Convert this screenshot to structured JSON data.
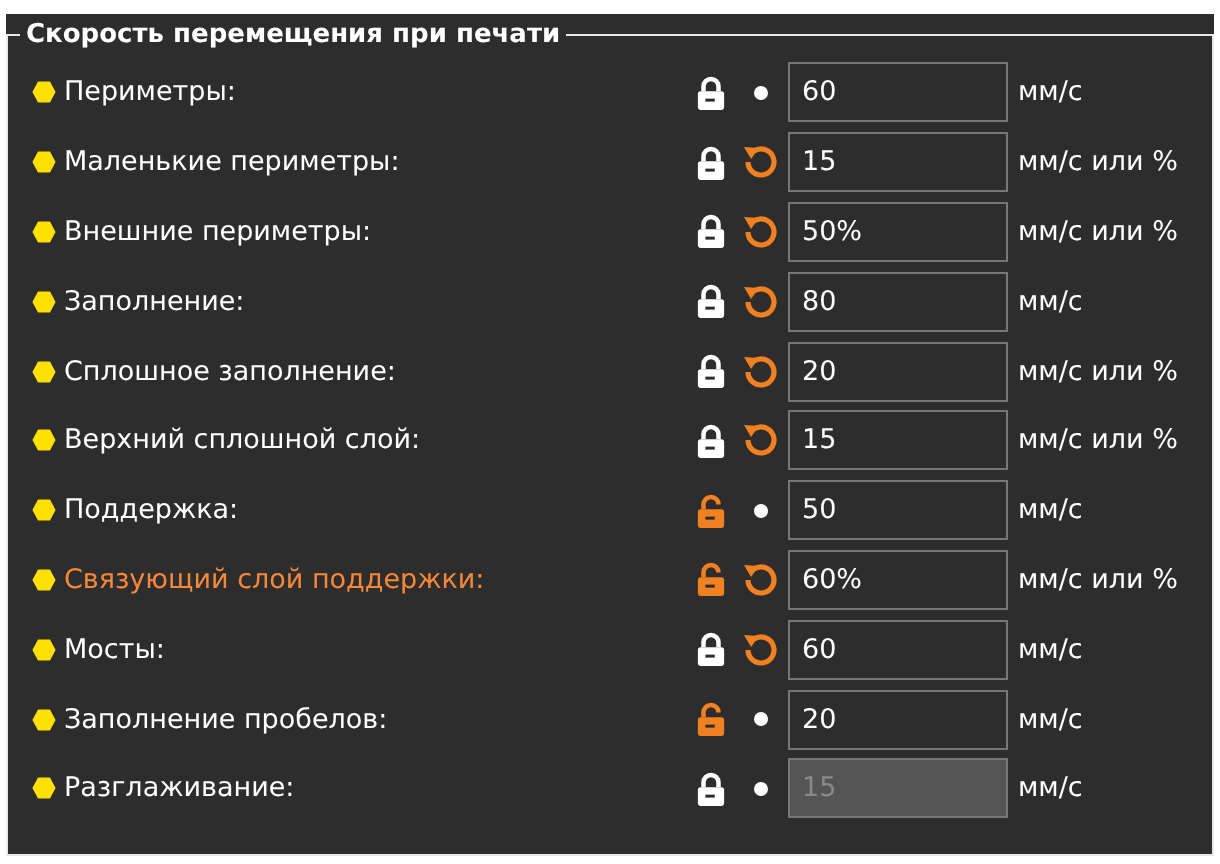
{
  "group": {
    "title": "Скорость перемещения при печати"
  },
  "rows": [
    {
      "label": "Периметры:",
      "locked": true,
      "modified": false,
      "highlighted": false,
      "value": "60",
      "disabled": false,
      "unit": "мм/с"
    },
    {
      "label": "Маленькие периметры:",
      "locked": true,
      "modified": true,
      "highlighted": false,
      "value": "15",
      "disabled": false,
      "unit": "мм/с или %"
    },
    {
      "label": "Внешние периметры:",
      "locked": true,
      "modified": true,
      "highlighted": false,
      "value": "50%",
      "disabled": false,
      "unit": "мм/с или %"
    },
    {
      "label": "Заполнение:",
      "locked": true,
      "modified": true,
      "highlighted": false,
      "value": "80",
      "disabled": false,
      "unit": "мм/с"
    },
    {
      "label": "Сплошное заполнение:",
      "locked": true,
      "modified": true,
      "highlighted": false,
      "value": "20",
      "disabled": false,
      "unit": "мм/с или %"
    },
    {
      "label": "Верхний сплошной слой:",
      "locked": true,
      "modified": true,
      "highlighted": false,
      "value": "15",
      "disabled": false,
      "unit": "мм/с или %"
    },
    {
      "label": "Поддержка:",
      "locked": false,
      "modified": false,
      "highlighted": false,
      "value": "50",
      "disabled": false,
      "unit": "мм/с"
    },
    {
      "label": "Связующий слой поддержки:",
      "locked": false,
      "modified": true,
      "highlighted": true,
      "value": "60%",
      "disabled": false,
      "unit": "мм/с или %"
    },
    {
      "label": "Мосты:",
      "locked": true,
      "modified": true,
      "highlighted": false,
      "value": "60",
      "disabled": false,
      "unit": "мм/с"
    },
    {
      "label": "Заполнение пробелов:",
      "locked": false,
      "modified": false,
      "highlighted": false,
      "value": "20",
      "disabled": false,
      "unit": "мм/с"
    },
    {
      "label": "Разглаживание:",
      "locked": true,
      "modified": false,
      "highlighted": false,
      "value": "15",
      "disabled": true,
      "unit": "мм/с"
    }
  ]
}
